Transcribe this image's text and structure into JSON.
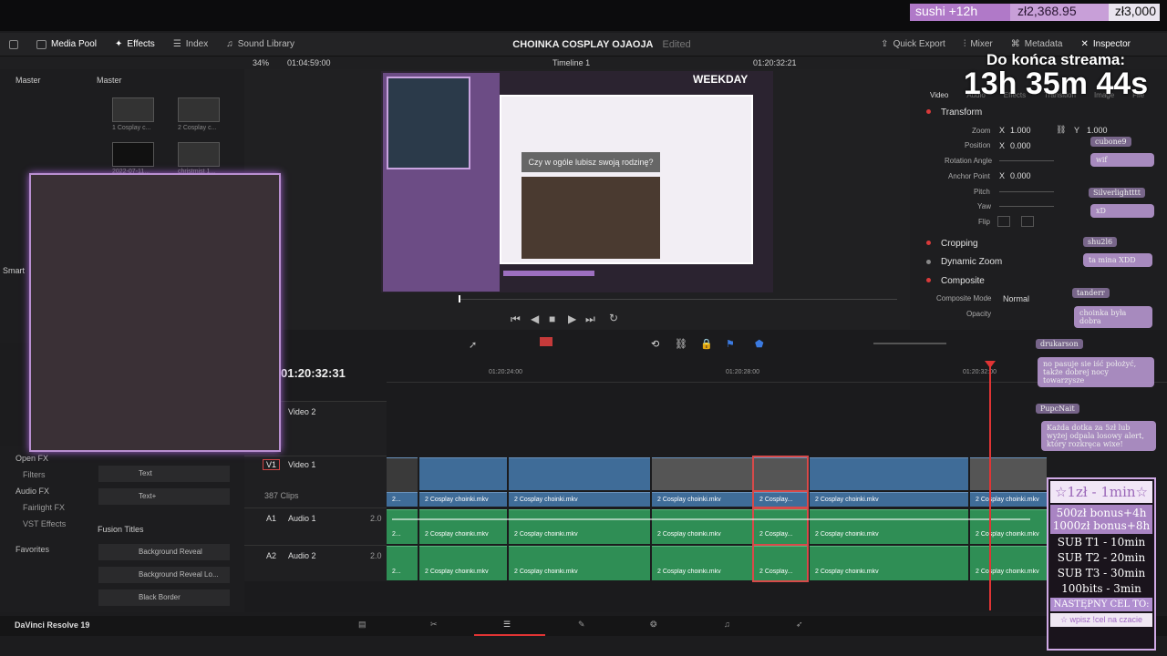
{
  "overlay": {
    "goal_label": "sushi +12h",
    "goal_current": "zł2,368.95",
    "goal_target": "zł3,000",
    "timer_title": "Do końca streama:",
    "timer_value": "13h 35m 44s"
  },
  "header": {
    "media_pool": "Media Pool",
    "effects": "Effects",
    "index": "Index",
    "sound_library": "Sound Library",
    "project_title": "CHOINKA COSPLAY OJAOJA",
    "edited": "Edited",
    "quick_export": "Quick Export",
    "mixer": "Mixer",
    "metadata": "Metadata",
    "inspector": "Inspector"
  },
  "subheader": {
    "zoom": "34%",
    "src_tc": "01:04:59:00",
    "timeline_name": "Timeline 1",
    "rec_tc": "01:20:32:21"
  },
  "media_pool": {
    "bin_left": "Master",
    "bin_right": "Master",
    "clips": [
      "1 Cosplay c...",
      "2 Cosplay c...",
      "2022-07-11...",
      "christmist 1..."
    ]
  },
  "viewer": {
    "question": "Czy w ogóle lubisz swoją rodzinę?",
    "brand": "WEEKDAY"
  },
  "inspector": {
    "tabs": [
      "Video",
      "Audio",
      "Effects",
      "Transition",
      "Image",
      "File"
    ],
    "transform": "Transform",
    "zoom_label": "Zoom",
    "zoom_x": "1.000",
    "zoom_y": "1.000",
    "position_label": "Position",
    "position_x": "0.000",
    "rotation_label": "Rotation Angle",
    "anchor_label": "Anchor Point",
    "anchor_x": "0.000",
    "pitch_label": "Pitch",
    "yaw_label": "Yaw",
    "flip_label": "Flip",
    "cropping": "Cropping",
    "dynamic_zoom": "Dynamic Zoom",
    "composite": "Composite",
    "composite_mode_label": "Composite Mode",
    "composite_mode_value": "Normal",
    "opacity_label": "Opacity"
  },
  "timeline": {
    "timecode": "01:20:32:31",
    "ruler": [
      "01:20:24:00",
      "01:20:28:00",
      "01:20:32:00"
    ],
    "tracks": [
      {
        "id": "",
        "name": "Video 2",
        "info": ""
      },
      {
        "id": "V1",
        "name": "Video 1",
        "info": "387 Clips"
      },
      {
        "id": "A1",
        "name": "Audio 1",
        "info": "2.0"
      },
      {
        "id": "A2",
        "name": "Audio 2",
        "info": "2.0"
      }
    ],
    "clip_name": "2 Cosplay choinki.mkv",
    "clip_short": "2 Cosplay...",
    "clip_tiny": "2..."
  },
  "left_panel": {
    "smart": "Smart",
    "open_fx": "Open FX",
    "filters": "Filters",
    "audio_fx": "Audio FX",
    "fairlight_fx": "Fairlight FX",
    "vst_effects": "VST Effects",
    "favorites": "Favorites",
    "items": [
      "Text",
      "Text+"
    ],
    "fusion_titles": "Fusion Titles",
    "fusion_items": [
      "Background Reveal",
      "Background Reveal Lo...",
      "Black Border"
    ]
  },
  "chat": [
    {
      "user": "cubone9",
      "msg": "wif"
    },
    {
      "user": "Silverlightttt",
      "msg": "xD"
    },
    {
      "user": "shu2l6",
      "msg": "ta mina XDD"
    },
    {
      "user": "tanderr",
      "msg": "choinka była dobra"
    },
    {
      "user": "drukarson",
      "msg": "no pasuje sie iść położyć, także dobrej nocy towarzysze"
    },
    {
      "user": "PupcNait",
      "msg": ""
    }
  ],
  "alert": "Każda dotka za 5zł lub wyżej odpala losowy alert, który rozkręca wixe!",
  "rates": {
    "title": "☆1zł - 1min☆",
    "bonus1": "500zł bonus+4h",
    "bonus2": "1000zł bonus+8h",
    "sub1": "SUB T1 - 10min",
    "sub2": "SUB T2 - 20min",
    "sub3": "SUB T3 - 30min",
    "bits": "100bits - 3min",
    "next": "NASTĘPNY CEL TO:",
    "cmd": "☆ wpisz !cel na czacie"
  },
  "bottom": {
    "app": "DaVinci Resolve 19"
  }
}
